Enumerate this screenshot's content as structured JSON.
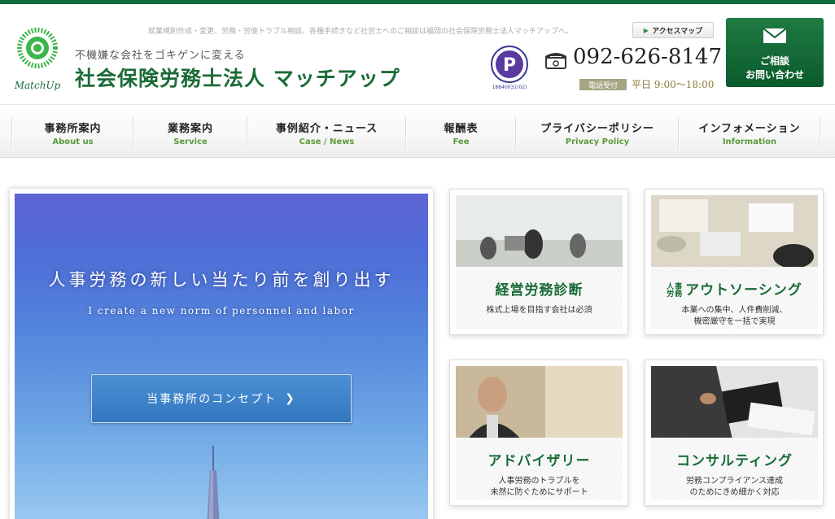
{
  "header": {
    "intro_text": "就業規則作成・変更、労務・労使トラブル相談、各種手続きなど社労士へのご相談は福岡の社会保険労務士法人マッチアップへ。",
    "tagline": "不機嫌な会社をゴキゲンに変える",
    "company_name": "社会保険労務士法人 マッチアップ",
    "logo_text": "MatchUp",
    "access_map_label": "アクセスマップ",
    "pmark_top": "たいせつにしますプライバシー",
    "pmark_number": "18840031(02)",
    "phone": "092-626-8147",
    "hours_badge": "電話受付",
    "hours": "平日 9:00〜18:00",
    "contact_line1": "ご相談",
    "contact_line2": "お問い合わせ"
  },
  "nav": {
    "items": [
      {
        "jp": "事務所案内",
        "en": "About us"
      },
      {
        "jp": "業務案内",
        "en": "Service"
      },
      {
        "jp": "事例紹介・ニュース",
        "en": "Case / News"
      },
      {
        "jp": "報酬表",
        "en": "Fee"
      },
      {
        "jp": "プライバシーポリシー",
        "en": "Privacy Policy"
      },
      {
        "jp": "インフォメーション",
        "en": "Information"
      }
    ]
  },
  "hero": {
    "title": "人事労務の新しい当たり前を創り出す",
    "subtitle": "I create a new norm of personnel and labor",
    "button_label": "当事務所のコンセプト",
    "button_arrow": "❯"
  },
  "cards": [
    {
      "title": "経営労務診断",
      "desc1": "株式上場を目指す会社は必須",
      "desc2": ""
    },
    {
      "title_prefix1": "人事",
      "title_prefix2": "労務",
      "title": "アウトソーシング",
      "desc1": "本業への集中、人件費削減、",
      "desc2": "機密厳守を一括で実現"
    },
    {
      "title": "アドバイザリー",
      "desc1": "人事労務のトラブルを",
      "desc2": "未然に防ぐためにサポート"
    },
    {
      "title": "コンサルティング",
      "desc1": "労務コンプライアンス達成",
      "desc2": "のためにきめ細かく対応"
    }
  ],
  "colors": {
    "brand_green": "#1a6b35",
    "top_bar": "#0e6b3b",
    "nav_en": "#5a9a3a"
  }
}
